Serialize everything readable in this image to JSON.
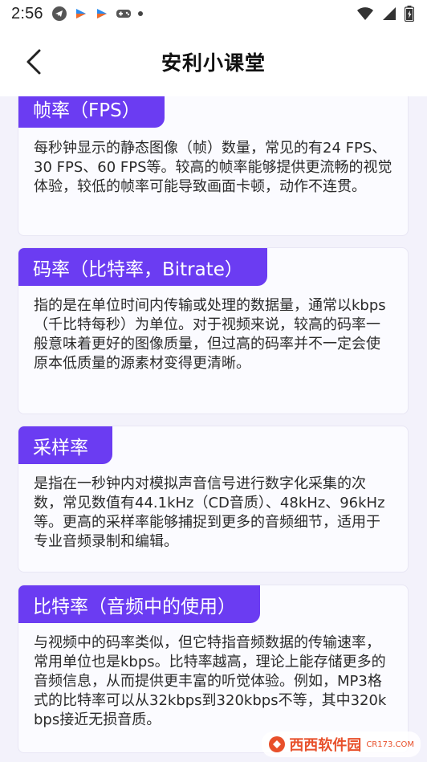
{
  "status_bar": {
    "time": "2:56",
    "icons": [
      "telegram-icon",
      "app-icon",
      "app-icon",
      "gamepad-icon",
      "dot-icon",
      "wifi-icon",
      "signal-icon",
      "battery-icon"
    ]
  },
  "header": {
    "title": "安利小课堂",
    "back_icon": "chevron-left-icon"
  },
  "cards": [
    {
      "title": "帧率（FPS）",
      "body": "每秒钟显示的静态图像（帧）数量，常见的有24 FPS、30 FPS、60 FPS等。较高的帧率能够提供更流畅的视觉体验，较低的帧率可能导致画面卡顿，动作不连贯。"
    },
    {
      "title": "码率（比特率，Bitrate）",
      "body": "指的是在单位时间内传输或处理的数据量，通常以kbps（千比特每秒）为单位。对于视频来说，较高的码率一般意味着更好的图像质量，但过高的码率并不一定会使原本低质量的源素材变得更清晰。"
    },
    {
      "title": "采样率",
      "body": "是指在一秒钟内对模拟声音信号进行数字化采集的次数，常见数值有44.1kHz（CD音质）、48kHz、96kHz等。更高的采样率能够捕捉到更多的音频细节，适用于专业音频录制和编辑。"
    },
    {
      "title": "比特率（音频中的使用）",
      "body": "与视频中的码率类似，但它特指音频数据的传输速率，常用单位也是kbps。比特率越高，理论上能存储更多的音频信息，从而提供更丰富的听觉体验。例如，MP3格式的比特率可以从32kbps到320kbps不等，其中320kbps接近无损音质。"
    }
  ],
  "watermark": {
    "text": "西西软件园",
    "sub": "CR173.COM"
  },
  "colors": {
    "accent": "#6b3cf2",
    "background": "#f3f2fb",
    "card": "#fbfbff"
  }
}
